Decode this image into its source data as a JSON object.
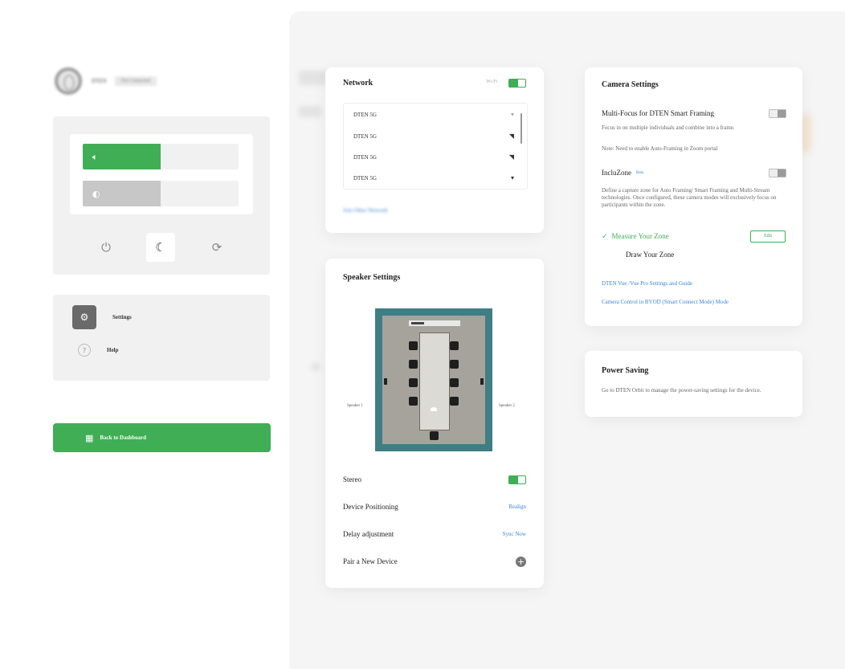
{
  "device": {
    "name": "DTEN",
    "badge": "Not Connected"
  },
  "menu": {
    "settings_label": "Settings",
    "help_label": "Help"
  },
  "sliders": {
    "volume_level": 0.5,
    "brightness_level": 0.5
  },
  "back_button_label": "Back to Dashboard",
  "network": {
    "title": "Network",
    "status": "Wi-Fi",
    "toggle_on": true,
    "items": [
      {
        "ssid": "DTEN 5G",
        "icon": "wifi-icon"
      },
      {
        "ssid": "DTEN 5G",
        "icon": "wifi-icon"
      },
      {
        "ssid": "DTEN 5G",
        "icon": "wifi-icon"
      },
      {
        "ssid": "DTEN 5G",
        "icon": "wifi-icon"
      }
    ],
    "join_link": "Join Other Network"
  },
  "speaker": {
    "title": "Speaker Settings",
    "speaker1_label": "Speaker 1",
    "speaker2_label": "Speaker 2",
    "stereo_label": "Stereo",
    "stereo_on": true,
    "positioning_label": "Device Positioning",
    "positioning_action": "Realign",
    "delay_label": "Delay adjustment",
    "delay_action": "Sync Now",
    "pair_label": "Pair a New Device"
  },
  "camera": {
    "title": "Camera Settings",
    "multifocus_label": "Multi-Focus for DTEN Smart Framing",
    "multifocus_desc": "Focus in on multiple individuals and combine into a frame.",
    "multifocus_note": "Note: Need to enable Auto-Framing in Zoom portal",
    "incluzone_label": "IncluZone",
    "incluzone_badge": "Beta",
    "incluzone_desc": "Define a capture zone for Auto Framing/ Smart Framing and Multi-Stream technologies. Once configured, these camera modes will exclusively focus on participants within the zone.",
    "measure_label": "Measure Your Zone",
    "edit_label": "Edit",
    "draw_label": "Draw Your Zone",
    "link_vue": "DTEN Vue /Vue Pro Settings and Guide",
    "link_byod": "Camera Control in BYOD (Smart Connect Mode) Mode"
  },
  "power": {
    "title": "Power Saving",
    "desc": "Go to DTEN Orbit to manage the power-saving settings for the device."
  },
  "colors": {
    "accent_green": "#3fae55",
    "link_blue": "#3b86d6"
  }
}
